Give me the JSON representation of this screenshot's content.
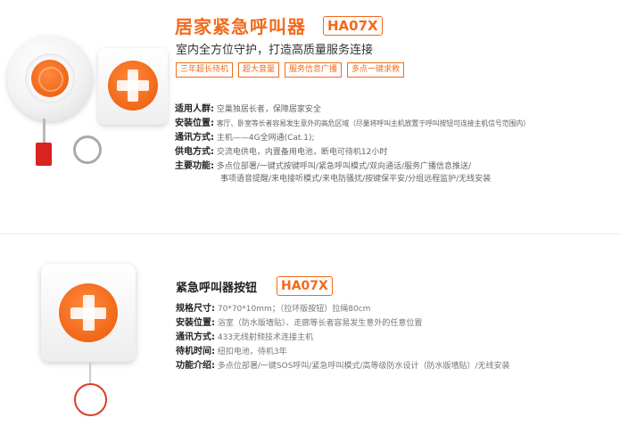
{
  "product1": {
    "title": "居家紧急呼叫器",
    "model": "HA07X",
    "subtitle": "室内全方位守护，打造高质量服务连接",
    "tags": [
      "三年超长待机",
      "超大音量",
      "服务信息广播",
      "多点一键求救"
    ],
    "specs": [
      {
        "label": "适用人群:",
        "value": "空巢独居长者，保障居家安全"
      },
      {
        "label": "安装位置:",
        "value": "客厅、卧室等长者容易发生意外的高危区域（尽量将呼叫主机放置于呼叫按钮可连接主机信号范围内）"
      },
      {
        "label": "通讯方式:",
        "value": "主机——4G全网通(Cat.1);"
      },
      {
        "label": "供电方式:",
        "value": "交流电供电，内置备用电池，断电可待机12小时"
      },
      {
        "label": "主要功能:",
        "value": "多点位部署/一键式按键呼叫/紧急呼叫模式/双向通话/服务广播信息推送/"
      },
      {
        "label": "",
        "value": "事项语音提醒/来电接听模式/来电防骚扰/按键保平安/分组远程监护/无线安装"
      }
    ]
  },
  "product2": {
    "title": "紧急呼叫器按钮",
    "model": "HA07X",
    "specs": [
      {
        "label": "规格尺寸:",
        "value": "70*70*10mm；（拉环版按钮）拉绳80cm"
      },
      {
        "label": "安装位置:",
        "value": "浴室（防水版墙贴）、走廊等长者容易发生意外的任意位置"
      },
      {
        "label": "通讯方式:",
        "value": "433无线射频技术连接主机"
      },
      {
        "label": "待机时间:",
        "value": "纽扣电池，待机3年"
      },
      {
        "label": "功能介绍:",
        "value": "多点位部署/一键SOS呼叫/紧急呼叫模式/高等级防水设计（防水版墙贴）/无线安装"
      }
    ]
  },
  "colors": {
    "accent": "#f26a1b",
    "cord_tag": "#d8231f"
  }
}
